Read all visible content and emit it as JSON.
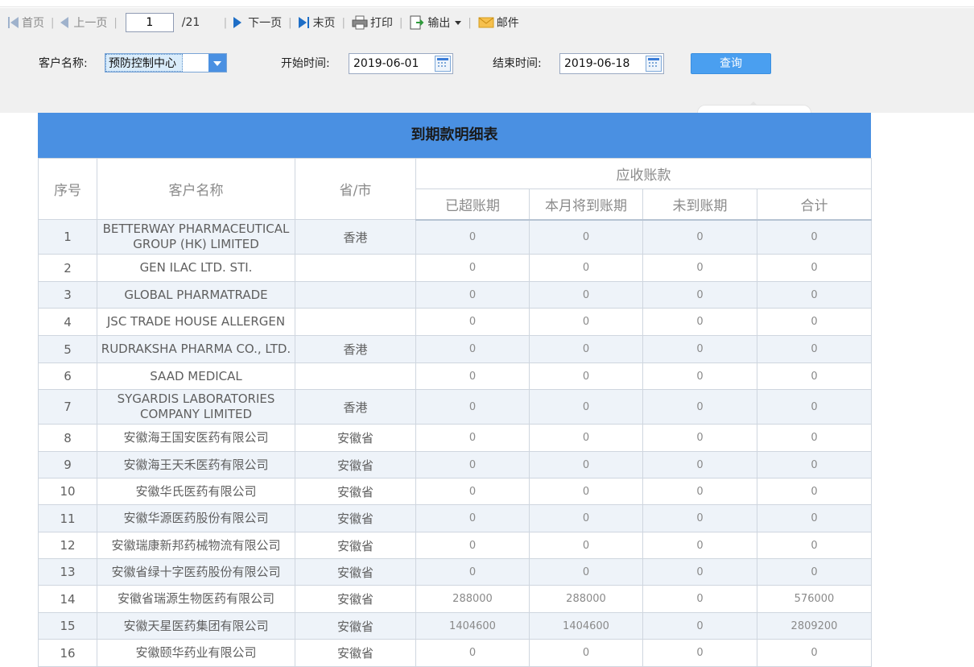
{
  "toolbar": {
    "first": "首页",
    "prev": "上一页",
    "page": "1",
    "total": "/21",
    "next": "下一页",
    "last": "末页",
    "print": "打印",
    "export": "输出",
    "mail": "邮件"
  },
  "filter": {
    "customer_label": "客户名称:",
    "customer_value": "预防控制中心",
    "start_label": "开始时间:",
    "start_value": "2019-06-01",
    "end_label": "结束时间:",
    "end_value": "2019-06-18",
    "query": "查询"
  },
  "report": {
    "title": "到期款明细表",
    "headers": {
      "index": "序号",
      "customer": "客户名称",
      "province": "省/市",
      "receivable": "应收账款",
      "overdue": "已超账期",
      "due_this_month": "本月将到账期",
      "not_due": "未到账期",
      "total": "合计"
    },
    "rows": [
      {
        "idx": "1",
        "name": "BETTERWAY PHARMACEUTICAL GROUP (HK) LIMITED",
        "prov": "香港",
        "a": "0",
        "b": "0",
        "c": "0",
        "d": "0"
      },
      {
        "idx": "2",
        "name": "GEN ILAC LTD. STI.",
        "prov": "",
        "a": "0",
        "b": "0",
        "c": "0",
        "d": "0"
      },
      {
        "idx": "3",
        "name": "GLOBAL PHARMATRADE",
        "prov": "",
        "a": "0",
        "b": "0",
        "c": "0",
        "d": "0"
      },
      {
        "idx": "4",
        "name": "JSC TRADE HOUSE ALLERGEN",
        "prov": "",
        "a": "0",
        "b": "0",
        "c": "0",
        "d": "0"
      },
      {
        "idx": "5",
        "name": "RUDRAKSHA PHARMA CO., LTD.",
        "prov": "香港",
        "a": "0",
        "b": "0",
        "c": "0",
        "d": "0"
      },
      {
        "idx": "6",
        "name": "SAAD MEDICAL",
        "prov": "",
        "a": "0",
        "b": "0",
        "c": "0",
        "d": "0"
      },
      {
        "idx": "7",
        "name": "SYGARDIS LABORATORIES COMPANY LIMITED",
        "prov": "香港",
        "a": "0",
        "b": "0",
        "c": "0",
        "d": "0"
      },
      {
        "idx": "8",
        "name": "安徽海王国安医药有限公司",
        "prov": "安徽省",
        "a": "0",
        "b": "0",
        "c": "0",
        "d": "0"
      },
      {
        "idx": "9",
        "name": "安徽海王天禾医药有限公司",
        "prov": "安徽省",
        "a": "0",
        "b": "0",
        "c": "0",
        "d": "0"
      },
      {
        "idx": "10",
        "name": "安徽华氏医药有限公司",
        "prov": "安徽省",
        "a": "0",
        "b": "0",
        "c": "0",
        "d": "0"
      },
      {
        "idx": "11",
        "name": "安徽华源医药股份有限公司",
        "prov": "安徽省",
        "a": "0",
        "b": "0",
        "c": "0",
        "d": "0"
      },
      {
        "idx": "12",
        "name": "安徽瑞康新邦药械物流有限公司",
        "prov": "安徽省",
        "a": "0",
        "b": "0",
        "c": "0",
        "d": "0"
      },
      {
        "idx": "13",
        "name": "安徽省绿十字医药股份有限公司",
        "prov": "安徽省",
        "a": "0",
        "b": "0",
        "c": "0",
        "d": "0"
      },
      {
        "idx": "14",
        "name": "安徽省瑞源生物医药有限公司",
        "prov": "安徽省",
        "a": "288000",
        "b": "288000",
        "c": "0",
        "d": "576000"
      },
      {
        "idx": "15",
        "name": "安徽天星医药集团有限公司",
        "prov": "安徽省",
        "a": "1404600",
        "b": "1404600",
        "c": "0",
        "d": "2809200"
      },
      {
        "idx": "16",
        "name": "安徽颐华药业有限公司",
        "prov": "安徽省",
        "a": "0",
        "b": "0",
        "c": "0",
        "d": "0"
      }
    ]
  }
}
